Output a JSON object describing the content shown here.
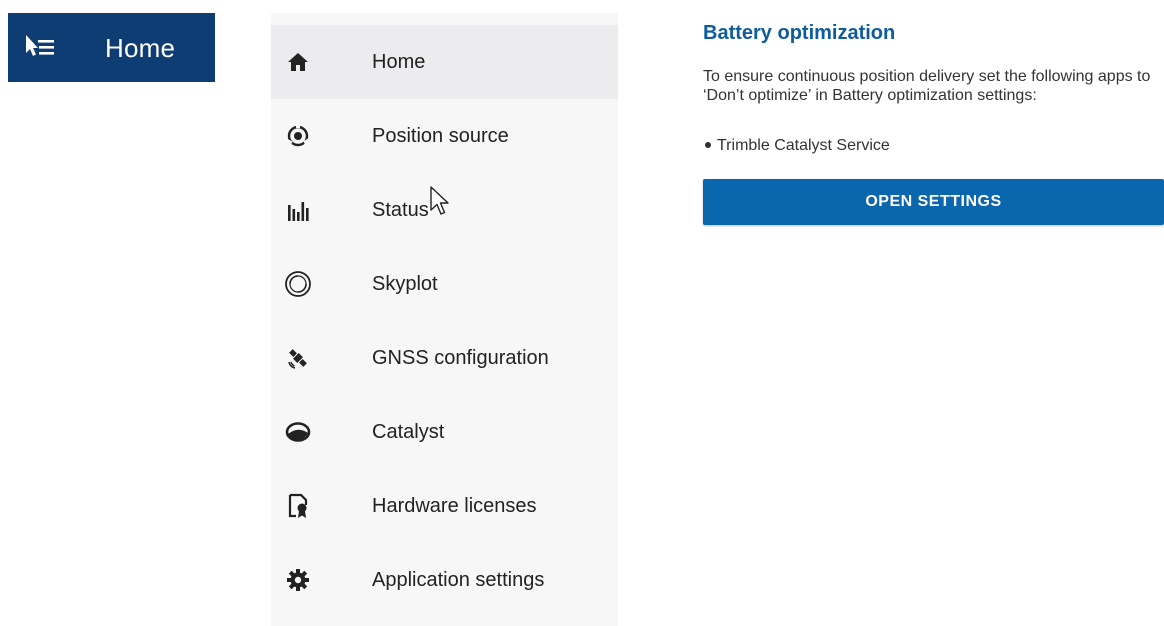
{
  "appbar": {
    "title": "Home",
    "menu_icon": "menu-open-icon",
    "background": "#0d3d73"
  },
  "drawer": {
    "items": [
      {
        "label": "Home",
        "icon": "home-icon",
        "active": true
      },
      {
        "label": "Position source",
        "icon": "position-source-icon",
        "active": false
      },
      {
        "label": "Status",
        "icon": "status-bars-icon",
        "active": false
      },
      {
        "label": "Skyplot",
        "icon": "skyplot-icon",
        "active": false
      },
      {
        "label": "GNSS configuration",
        "icon": "satellite-icon",
        "active": false
      },
      {
        "label": "Catalyst",
        "icon": "catalyst-icon",
        "active": false
      },
      {
        "label": "Hardware licenses",
        "icon": "license-icon",
        "active": false
      },
      {
        "label": "Application settings",
        "icon": "gear-icon",
        "active": false
      }
    ]
  },
  "content": {
    "title": "Battery optimization",
    "description": "To ensure continuous position delivery set the following apps to ‘Don’t optimize’ in Battery optimization settings:",
    "apps": [
      "Trimble Catalyst Service"
    ],
    "button_label": "OPEN SETTINGS"
  },
  "colors": {
    "accent": "#0d5c9e",
    "button": "#0a66ad",
    "drawer_bg": "#f7f7f8",
    "active_item_bg": "#ececef"
  }
}
